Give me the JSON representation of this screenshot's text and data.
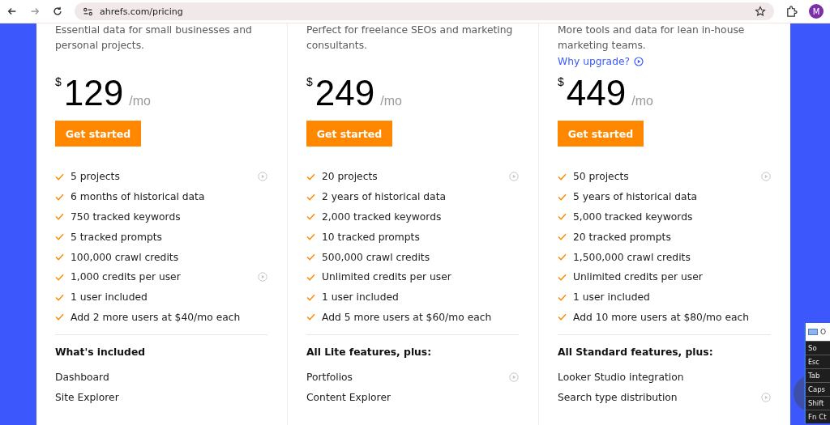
{
  "browser": {
    "url": "ahrefs.com/pricing",
    "profile_initial": "M"
  },
  "plans": [
    {
      "description": "Essential data for small businesses and personal projects.",
      "price_currency": "$",
      "price": "129",
      "period": "/mo",
      "button": "Get started",
      "features": [
        {
          "text": "5 projects",
          "video": true
        },
        {
          "text": "6 months of historical data",
          "video": false
        },
        {
          "text": "750 tracked keywords",
          "video": false
        },
        {
          "text": "5 tracked prompts",
          "video": false
        },
        {
          "text": "100,000 crawl credits",
          "video": false
        },
        {
          "text": "1,000 credits per user",
          "video": true
        },
        {
          "text": "1 user included",
          "video": false
        },
        {
          "text": "Add 2 more users at $40/mo each",
          "video": false
        }
      ],
      "included_heading": "What's included",
      "included": [
        {
          "text": "Dashboard",
          "video": false
        },
        {
          "text": "Site Explorer",
          "video": false
        }
      ]
    },
    {
      "description": "Perfect for freelance SEOs and marketing consultants.",
      "price_currency": "$",
      "price": "249",
      "period": "/mo",
      "button": "Get started",
      "features": [
        {
          "text": "20 projects",
          "video": true
        },
        {
          "text": "2 years of historical data",
          "video": false
        },
        {
          "text": "2,000 tracked keywords",
          "video": false
        },
        {
          "text": "10 tracked prompts",
          "video": false
        },
        {
          "text": "500,000 crawl credits",
          "video": false
        },
        {
          "text": "Unlimited credits per user",
          "video": false
        },
        {
          "text": "1 user included",
          "video": false
        },
        {
          "text": "Add 5 more users at $60/mo each",
          "video": false
        }
      ],
      "included_heading": "All Lite features, plus:",
      "included": [
        {
          "text": "Portfolios",
          "video": true
        },
        {
          "text": "Content Explorer",
          "video": false
        }
      ]
    },
    {
      "description": "More tools and data for lean in-house marketing teams.",
      "link": "Why upgrade?",
      "price_currency": "$",
      "price": "449",
      "period": "/mo",
      "button": "Get started",
      "features": [
        {
          "text": "50 projects",
          "video": true
        },
        {
          "text": "5 years of historical data",
          "video": false
        },
        {
          "text": "5,000 tracked keywords",
          "video": false
        },
        {
          "text": "20 tracked prompts",
          "video": false
        },
        {
          "text": "1,500,000 crawl credits",
          "video": false
        },
        {
          "text": "Unlimited credits per user",
          "video": false
        },
        {
          "text": "1 user included",
          "video": false
        },
        {
          "text": "Add 10 more users at $80/mo each",
          "video": false
        }
      ],
      "included_heading": "All Standard features, plus:",
      "included": [
        {
          "text": "Looker Studio integration",
          "video": false
        },
        {
          "text": "Search type distribution",
          "video": true
        }
      ]
    }
  ],
  "keyboard": {
    "title": "O",
    "keys": [
      "So",
      "Esc",
      "Tab",
      "Caps",
      "Shift",
      "Fn",
      "Ct"
    ]
  }
}
